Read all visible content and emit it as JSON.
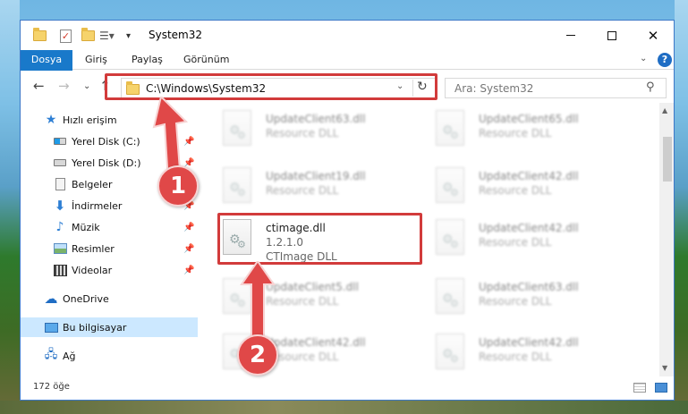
{
  "window": {
    "title": "System32"
  },
  "ribbon": {
    "tabs": [
      "Dosya",
      "Giriş",
      "Paylaş",
      "Görünüm"
    ],
    "expand_icon": "chevron-down-icon",
    "help_label": "?"
  },
  "nav": {
    "address": "C:\\Windows\\System32",
    "search_placeholder": "Ara: System32"
  },
  "sidebar": {
    "items": [
      {
        "label": "Hızlı erişim",
        "icon": "star-icon",
        "pinned": false
      },
      {
        "label": "Yerel Disk (C:)",
        "icon": "drive-icon",
        "pinned": true
      },
      {
        "label": "Yerel Disk (D:)",
        "icon": "drive-icon",
        "pinned": true
      },
      {
        "label": "Belgeler",
        "icon": "document-icon",
        "pinned": true
      },
      {
        "label": "İndirmeler",
        "icon": "download-icon",
        "pinned": true
      },
      {
        "label": "Müzik",
        "icon": "music-icon",
        "pinned": true
      },
      {
        "label": "Resimler",
        "icon": "pictures-icon",
        "pinned": true
      },
      {
        "label": "Videolar",
        "icon": "video-icon",
        "pinned": true
      },
      {
        "label": "OneDrive",
        "icon": "cloud-icon",
        "pinned": false
      },
      {
        "label": "Bu bilgisayar",
        "icon": "computer-icon",
        "pinned": false,
        "selected": true
      },
      {
        "label": "Ağ",
        "icon": "network-icon",
        "pinned": false
      }
    ]
  },
  "files": {
    "left": [
      {
        "name": "UpdateClient63.dll",
        "sub": "Resource DLL"
      },
      {
        "name": "UpdateClient19.dll",
        "sub": "Resource DLL"
      },
      {
        "name": "ctimage.dll",
        "version": "1.2.1.0",
        "sub": "CTImage DLL"
      },
      {
        "name": "UpdateClient5.dll",
        "sub": "Resource DLL"
      },
      {
        "name": "UpdateClient42.dll",
        "sub": "Resource DLL"
      }
    ],
    "right": [
      {
        "name": "UpdateClient65.dll",
        "sub": "Resource DLL"
      },
      {
        "name": "UpdateClient42.dll",
        "sub": "Resource DLL"
      },
      {
        "name": "UpdateClient42.dll",
        "sub": "Resource DLL"
      },
      {
        "name": "UpdateClient63.dll",
        "sub": "Resource DLL"
      },
      {
        "name": "UpdateClient42.dll",
        "sub": "Resource DLL"
      }
    ]
  },
  "status": {
    "count": "172 öğe"
  },
  "annotations": {
    "callout_1": "1",
    "callout_2": "2",
    "color": "#e04848"
  }
}
